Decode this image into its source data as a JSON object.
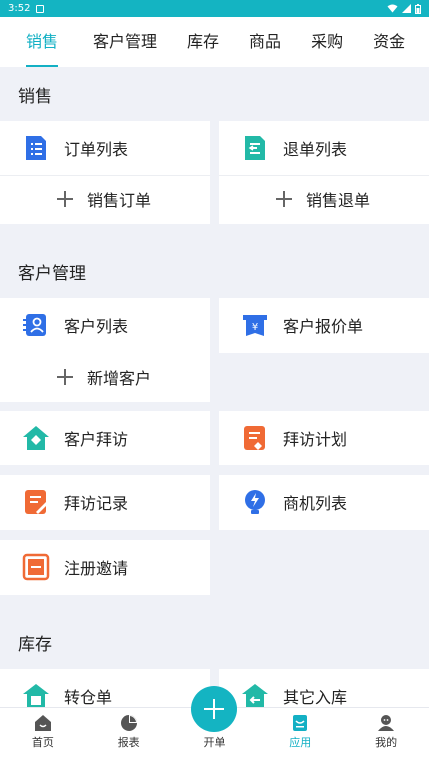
{
  "status_bar": {
    "time": "3:52"
  },
  "tabs": [
    {
      "label": "销售",
      "active": true
    },
    {
      "label": "客户管理"
    },
    {
      "label": "库存"
    },
    {
      "label": "商品"
    },
    {
      "label": "采购"
    },
    {
      "label": "资金"
    }
  ],
  "sections": {
    "sales": {
      "title": "销售",
      "order_list": "订单列表",
      "return_list": "退单列表",
      "sales_order": "销售订单",
      "sales_return": "销售退单"
    },
    "customer": {
      "title": "客户管理",
      "customer_list": "客户列表",
      "quote_list": "客户报价单",
      "add_customer": "新增客户",
      "visit": "客户拜访",
      "visit_plan": "拜访计划",
      "visit_record": "拜访记录",
      "opportunity_list": "商机列表",
      "register_invite": "注册邀请"
    },
    "inventory": {
      "title": "库存",
      "transfer": "转仓单",
      "other_in": "其它入库"
    }
  },
  "bottom_nav": [
    {
      "label": "首页",
      "icon": "home-icon"
    },
    {
      "label": "报表",
      "icon": "report-icon"
    },
    {
      "label": "开单",
      "icon": "plus-icon"
    },
    {
      "label": "应用",
      "icon": "apps-icon",
      "active": true
    },
    {
      "label": "我的",
      "icon": "profile-icon"
    }
  ],
  "colors": {
    "accent": "#13b0c4",
    "blue": "#2f6fe6",
    "teal": "#22b9a7",
    "orange": "#f06a35",
    "background": "#eff1f7"
  }
}
